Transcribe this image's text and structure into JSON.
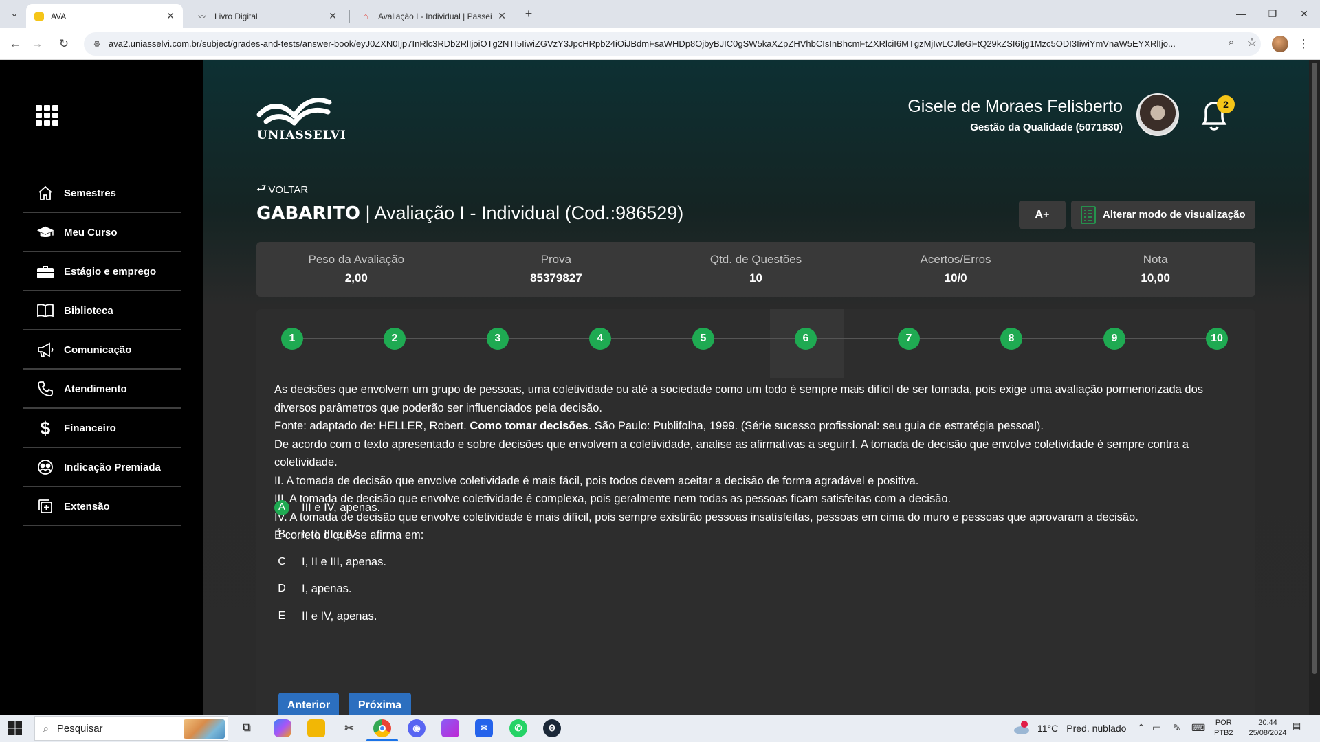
{
  "browser": {
    "tabs": [
      {
        "title": "AVA",
        "active": true
      },
      {
        "title": "Livro Digital",
        "active": false
      },
      {
        "title": "Avaliação I - Individual | Passei Di",
        "active": false
      }
    ],
    "url": "ava2.uniasselvi.com.br/subject/grades-and-tests/answer-book/eyJ0ZXN0Ijp7InRlc3RDb2RlIjoiOTg2NTI5IiwiZGVzY3JpcHRpb24iOiJBdmFsaWHDp8OjbyBJIC0gSW5kaXZpZHVhbCIsInBhcmFtZXRlciI6MTgzMjIwLCJleGFtQ29kZSI6Ijg1Mzc5ODI3IiwiYmVnaW5EYXRlIjo..."
  },
  "sidebar": {
    "items": [
      {
        "label": "Semestres",
        "icon": "home-icon"
      },
      {
        "label": "Meu Curso",
        "icon": "graduation-cap-icon"
      },
      {
        "label": "Estágio e emprego",
        "icon": "briefcase-icon"
      },
      {
        "label": "Biblioteca",
        "icon": "book-icon"
      },
      {
        "label": "Comunicação",
        "icon": "megaphone-icon"
      },
      {
        "label": "Atendimento",
        "icon": "phone-icon"
      },
      {
        "label": "Financeiro",
        "icon": "dollar-icon"
      },
      {
        "label": "Indicação Premiada",
        "icon": "referral-icon"
      },
      {
        "label": "Extensão",
        "icon": "extension-icon"
      }
    ]
  },
  "header": {
    "logo_text": "UNIASSELVI",
    "user_name": "Gisele de Moraes Felisberto",
    "course": "Gestão da Qualidade (5071830)",
    "notifications": "2"
  },
  "page": {
    "back_label": "VOLTAR",
    "title_bold": "GABARITO",
    "title_rest": " | Avaliação I - Individual (Cod.:986529)",
    "font_button": "A+",
    "view_button": "Alterar modo de visualização"
  },
  "summary": [
    {
      "label": "Peso da Avaliação",
      "value": "2,00"
    },
    {
      "label": "Prova",
      "value": "85379827"
    },
    {
      "label": "Qtd. de Questões",
      "value": "10"
    },
    {
      "label": "Acertos/Erros",
      "value": "10/0"
    },
    {
      "label": "Nota",
      "value": "10,00"
    }
  ],
  "questions": [
    "1",
    "2",
    "3",
    "4",
    "5",
    "6",
    "7",
    "8",
    "9",
    "10"
  ],
  "current_question": "6",
  "question": {
    "line1": "As decisões que envolvem um grupo de pessoas, uma coletividade ou até a sociedade como um todo é sempre mais difícil de ser tomada, pois exige uma avaliação pormenorizada dos diversos parâmetros que poderão ser influenciados pela decisão.",
    "source_prefix": "Fonte: adaptado de: HELLER, Robert. ",
    "source_book": "Como tomar decisões",
    "source_suffix": ". São Paulo: Publifolha, 1999. (Série sucesso profissional: seu guia de estratégia pessoal).",
    "line3": "De acordo com o texto apresentado e sobre decisões que envolvem a coletividade, analise as afirmativas a seguir:I. A tomada de decisão que envolve coletividade é sempre contra a coletividade.",
    "line4": "II. A tomada de decisão que envolve coletividade é mais fácil, pois todos devem aceitar a decisão de forma agradável e positiva.",
    "line5": "III. A tomada de decisão que envolve coletividade é complexa, pois geralmente nem todas as pessoas ficam satisfeitas com a decisão.",
    "line6": "IV. A tomada de decisão que envolve coletividade é mais difícil, pois sempre existirão pessoas insatisfeitas, pessoas em cima do muro e pessoas que aprovaram a decisão.",
    "line7": " É correto o que se afirma em:"
  },
  "options": [
    {
      "letter": "A",
      "text": "III e IV, apenas.",
      "correct": true
    },
    {
      "letter": "B",
      "text": "I, II, III e IV.",
      "correct": false
    },
    {
      "letter": "C",
      "text": "I, II e III, apenas.",
      "correct": false
    },
    {
      "letter": "D",
      "text": "I, apenas.",
      "correct": false
    },
    {
      "letter": "E",
      "text": "II e IV, apenas.",
      "correct": false
    }
  ],
  "buttons": {
    "prev": "Anterior",
    "next": "Próxima"
  },
  "colors": {
    "correct": "#1faa52",
    "primary": "#2c6fbf",
    "badge": "#f5c518"
  },
  "taskbar": {
    "search_placeholder": "Pesquisar",
    "weather_temp": "11°C",
    "weather_desc": "Pred. nublado",
    "lang_top": "POR",
    "lang_bottom": "PTB2",
    "time": "20:44",
    "date": "25/08/2024",
    "apps": [
      "task-view-icon",
      "copilot-icon",
      "file-explorer-icon",
      "snipping-icon",
      "chrome-icon",
      "discord-icon",
      "clapper-icon",
      "mail-icon",
      "whatsapp-icon",
      "steam-icon"
    ]
  }
}
